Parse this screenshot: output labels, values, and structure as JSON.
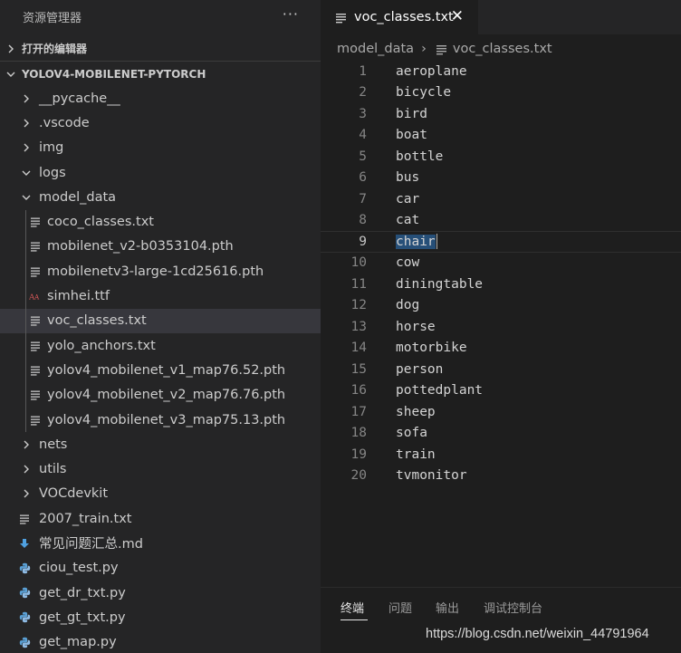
{
  "sidebar": {
    "title": "资源管理器",
    "more_label": "···",
    "open_editors_label": "打开的编辑器",
    "project_label": "YOLOV4-MOBILENET-PYTORCH",
    "tree": [
      {
        "label": "__pycache__",
        "type": "folder",
        "expanded": false,
        "depth": 1
      },
      {
        "label": ".vscode",
        "type": "folder",
        "expanded": false,
        "depth": 1
      },
      {
        "label": "img",
        "type": "folder",
        "expanded": false,
        "depth": 1
      },
      {
        "label": "logs",
        "type": "folder",
        "expanded": true,
        "depth": 1
      },
      {
        "label": "model_data",
        "type": "folder",
        "expanded": true,
        "depth": 1
      },
      {
        "label": "coco_classes.txt",
        "type": "text",
        "depth": 2
      },
      {
        "label": "mobilenet_v2-b0353104.pth",
        "type": "text",
        "depth": 2
      },
      {
        "label": "mobilenetv3-large-1cd25616.pth",
        "type": "text",
        "depth": 2
      },
      {
        "label": "simhei.ttf",
        "type": "font",
        "depth": 2
      },
      {
        "label": "voc_classes.txt",
        "type": "text",
        "depth": 2,
        "selected": true
      },
      {
        "label": "yolo_anchors.txt",
        "type": "text",
        "depth": 2
      },
      {
        "label": "yolov4_mobilenet_v1_map76.52.pth",
        "type": "text",
        "depth": 2
      },
      {
        "label": "yolov4_mobilenet_v2_map76.76.pth",
        "type": "text",
        "depth": 2
      },
      {
        "label": "yolov4_mobilenet_v3_map75.13.pth",
        "type": "text",
        "depth": 2
      },
      {
        "label": "nets",
        "type": "folder",
        "expanded": false,
        "depth": 1
      },
      {
        "label": "utils",
        "type": "folder",
        "expanded": false,
        "depth": 1
      },
      {
        "label": "VOCdevkit",
        "type": "folder",
        "expanded": false,
        "depth": 1
      },
      {
        "label": "2007_train.txt",
        "type": "text",
        "depth": 0
      },
      {
        "label": "常见问题汇总.md",
        "type": "markdown",
        "depth": 0
      },
      {
        "label": "ciou_test.py",
        "type": "python",
        "depth": 0
      },
      {
        "label": "get_dr_txt.py",
        "type": "python",
        "depth": 0
      },
      {
        "label": "get_gt_txt.py",
        "type": "python",
        "depth": 0
      },
      {
        "label": "get_map.py",
        "type": "python",
        "depth": 0
      }
    ]
  },
  "editor": {
    "tab_label": "voc_classes.txt",
    "tab_close": "✕",
    "breadcrumb": {
      "folder": "model_data",
      "separator": "›",
      "file": "voc_classes.txt"
    },
    "current_line": 9,
    "lines": [
      "aeroplane",
      "bicycle",
      "bird",
      "boat",
      "bottle",
      "bus",
      "car",
      "cat",
      "chair",
      "cow",
      "diningtable",
      "dog",
      "horse",
      "motorbike",
      "person",
      "pottedplant",
      "sheep",
      "sofa",
      "train",
      "tvmonitor"
    ]
  },
  "panel": {
    "tabs": [
      {
        "label": "终端",
        "active": true
      },
      {
        "label": "问题",
        "active": false
      },
      {
        "label": "输出",
        "active": false
      },
      {
        "label": "调试控制台",
        "active": false
      }
    ]
  },
  "watermark": "https://blog.csdn.net/weixin_44791964",
  "colors": {
    "accent_python": "#5a9fd4",
    "font_icon": "#e05b5b",
    "md_icon": "#4fa0e0",
    "selection": "#264f78"
  }
}
